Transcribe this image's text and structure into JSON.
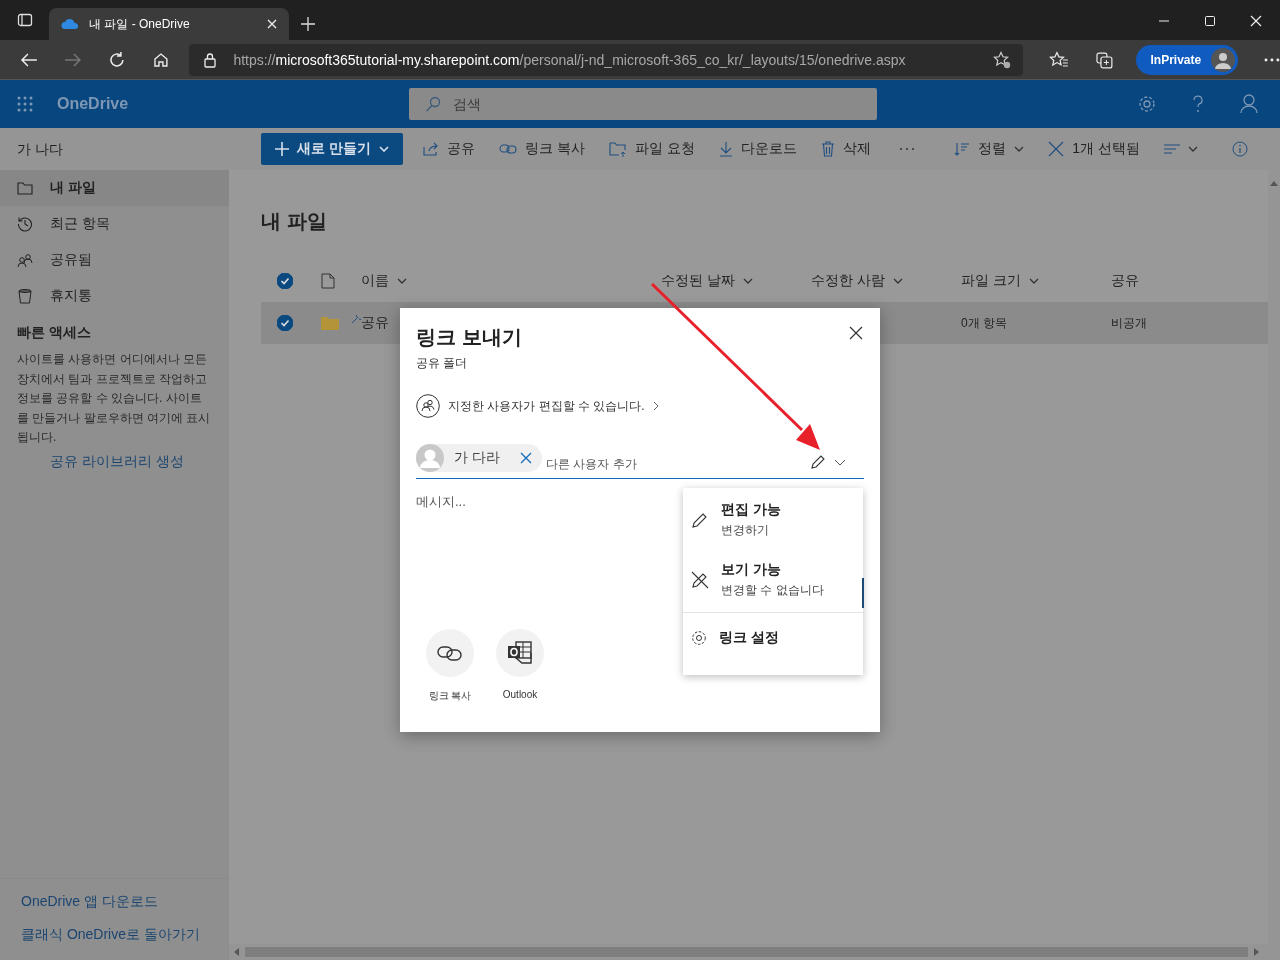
{
  "browser": {
    "tab_title": "내 파일 - OneDrive",
    "url_scheme": "https://",
    "url_host": "microsoft365tutorial-my.sharepoint.com",
    "url_path": "/personal/j-nd_microsoft-365_co_kr/_layouts/15/onedrive.aspx",
    "inprivate_label": "InPrivate"
  },
  "app": {
    "name": "OneDrive",
    "search": {
      "placeholder": "검색"
    }
  },
  "sidebar": {
    "user": "가 나다",
    "items": [
      {
        "label": "내 파일",
        "selected": true
      },
      {
        "label": "최근 항목",
        "selected": false
      },
      {
        "label": "공유됨",
        "selected": false
      },
      {
        "label": "휴지통",
        "selected": false
      }
    ],
    "quick_access_title": "빠른 액세스",
    "quick_access_text": "사이트를 사용하면 어디에서나 모든 장치에서 팀과 프로젝트로 작업하고 정보를 공유할 수 있습니다. 사이트를 만들거나 팔로우하면 여기에 표시됩니다.",
    "create_link": "공유 라이브러리 생성",
    "footer_links": [
      "OneDrive 앱 다운로드",
      "클래식 OneDrive로 돌아가기"
    ]
  },
  "commands": {
    "new_button": "새로 만들기",
    "items": [
      "공유",
      "링크 복사",
      "파일 요청",
      "다운로드",
      "삭제"
    ],
    "sort": "정렬",
    "selected_count": "1개 선택됨"
  },
  "main": {
    "title": "내 파일",
    "select_all_checked": true,
    "columns": [
      "이름",
      "수정된 날짜",
      "수정한 사람",
      "파일 크기",
      "공유"
    ],
    "rows": [
      {
        "name": "공유",
        "size": "0개 항목",
        "sharing": "비공개",
        "selected": true
      }
    ]
  },
  "dialog": {
    "title": "링크 보내기",
    "subtitle": "공유 폴더",
    "permission": "지정한 사용자가 편집할 수 있습니다.",
    "recipient": "가 다라",
    "add_placeholder": "다른 사용자 추가",
    "message_placeholder": "메시지...",
    "actions": [
      {
        "label": "링크 복사"
      },
      {
        "label": "Outlook"
      }
    ]
  },
  "menu": {
    "items": [
      {
        "kind": "option",
        "title": "편집 가능",
        "subtitle": "변경하기"
      },
      {
        "kind": "option",
        "title": "보기 가능",
        "subtitle": "변경할 수 없습니다"
      },
      {
        "kind": "setting",
        "title": "링크 설정"
      }
    ]
  }
}
